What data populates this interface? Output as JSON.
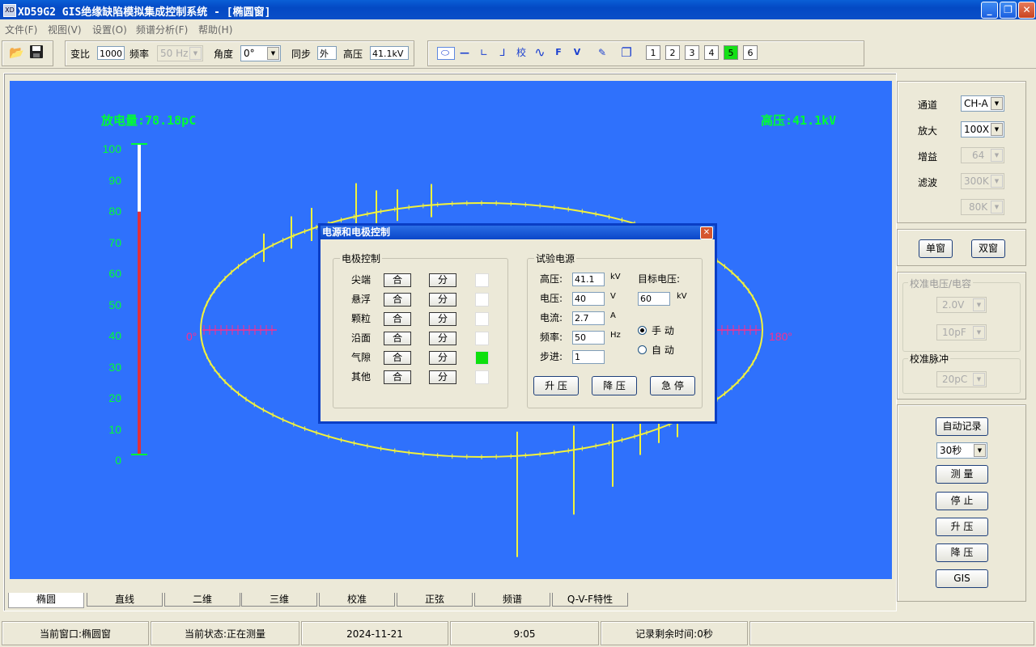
{
  "app": {
    "title": "XD59G2 GIS绝缘缺陷模拟集成控制系统 - [椭圆窗]",
    "icon_label": "XD"
  },
  "menu": [
    {
      "label": "文件(F)"
    },
    {
      "label": "视图(V)"
    },
    {
      "label": "设置(O)"
    },
    {
      "label": "频谱分析(F)"
    },
    {
      "label": "帮助(H)"
    }
  ],
  "toolbar": {
    "ratio_label": "变比",
    "ratio_value": "1000",
    "freq_label": "频率",
    "freq_value": "50 Hz",
    "angle_label": "角度",
    "angle_value": "0°",
    "sync_label": "同步",
    "sync_value": "外",
    "hv_label": "高压",
    "hv_value": "41.1kV",
    "tools": [
      {
        "icon": "ellipse-icon",
        "glyph": "⬭"
      },
      {
        "icon": "line-icon",
        "glyph": "—"
      },
      {
        "icon": "axis-icon",
        "glyph": "∟"
      },
      {
        "icon": "3d-axis-icon",
        "glyph": "⅃"
      },
      {
        "icon": "calibrate-icon",
        "glyph": "校"
      },
      {
        "icon": "sine-icon",
        "glyph": "∿"
      },
      {
        "icon": "f-icon",
        "glyph": "F"
      },
      {
        "icon": "v-icon",
        "glyph": "V"
      },
      {
        "icon": "draw-icon",
        "glyph": "✎"
      },
      {
        "icon": "window-icon",
        "glyph": "❐"
      }
    ],
    "channels": [
      "1",
      "2",
      "3",
      "4",
      "5",
      "6"
    ],
    "active_channel": "5"
  },
  "plot": {
    "discharge_label": "放电量:78.18pC",
    "hv_label": "高压:41.1kV",
    "y_ticks": [
      "100",
      "90",
      "80",
      "70",
      "60",
      "50",
      "40",
      "30",
      "20",
      "10",
      "0"
    ],
    "bar_level_fraction": 0.7818,
    "angle_left": "0°",
    "angle_right": "180°",
    "colors": {
      "background": "#2f71fc",
      "text": "#00ff33",
      "trace": "#f2f23c",
      "axis_marker": "#ff2d8a",
      "bar": "#e0303a"
    }
  },
  "tabs": [
    "椭圆",
    "直线",
    "二维",
    "三维",
    "校准",
    "正弦",
    "频谱",
    "Q-V-F特性"
  ],
  "active_tab": "椭圆",
  "right_panel": {
    "channel_label": "通道",
    "channel_value": "CH-A",
    "zoom_label": "放大",
    "zoom_value": "100X",
    "gain_label": "增益",
    "gain_value": "64",
    "filter_label": "滤波",
    "filter_value": "300K",
    "filter_value2": "80K",
    "single_window": "单窗",
    "dual_window": "双窗",
    "cal_vc_label": "校准电压/电容",
    "cal_voltage": "2.0V",
    "cal_capacitance": "10pF",
    "cal_pulse_label": "校准脉冲",
    "cal_pulse": "20pC",
    "auto_record": "自动记录",
    "record_time": "30秒",
    "measure": "测 量",
    "stop": "停 止",
    "raise": "升 压",
    "lower": "降 压",
    "gis": "GIS"
  },
  "dialog": {
    "title": "电源和电极控制",
    "electrode_group": "电极控制",
    "electrodes": [
      {
        "name": "尖端",
        "on": "合",
        "off": "分",
        "active": false
      },
      {
        "name": "悬浮",
        "on": "合",
        "off": "分",
        "active": false
      },
      {
        "name": "颗粒",
        "on": "合",
        "off": "分",
        "active": false
      },
      {
        "name": "沿面",
        "on": "合",
        "off": "分",
        "active": false
      },
      {
        "name": "气隙",
        "on": "合",
        "off": "分",
        "active": true
      },
      {
        "name": "其他",
        "on": "合",
        "off": "分",
        "active": false
      }
    ],
    "power_group": "试验电源",
    "hv_label": "高压:",
    "hv_value": "41.1",
    "hv_unit": "kV",
    "voltage_label": "电压:",
    "voltage_value": "40",
    "voltage_unit": "V",
    "current_label": "电流:",
    "current_value": "2.7",
    "current_unit": "A",
    "freq_label": "频率:",
    "freq_value": "50",
    "freq_unit": "Hz",
    "step_label": "步进:",
    "step_value": "1",
    "target_label": "目标电压:",
    "target_value": "60",
    "target_unit": "kV",
    "manual_label": "手 动",
    "auto_label": "自 动",
    "mode": "manual",
    "raise_button": "升 压",
    "lower_button": "降 压",
    "stop_button": "急 停"
  },
  "statusbar": {
    "window": "当前窗口:椭圆窗",
    "state": "当前状态:正在测量",
    "date": "2024-11-21",
    "time": "9:05",
    "remaining": "记录剩余时间:0秒"
  }
}
